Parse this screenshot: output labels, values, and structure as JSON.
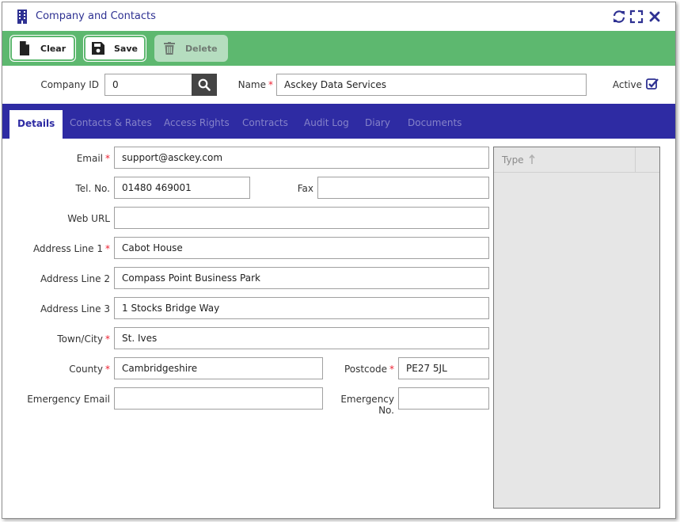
{
  "window": {
    "title": "Company and Contacts"
  },
  "toolbar": {
    "clear_label": "Clear",
    "save_label": "Save",
    "delete_label": "Delete"
  },
  "header": {
    "company_id_label": "Company ID",
    "company_id_value": "0",
    "name_label": "Name",
    "name_value": "Asckey Data Services",
    "active_label": "Active",
    "active_checked": true,
    "required_marker": "*"
  },
  "tabs": [
    {
      "label": "Details",
      "active": true
    },
    {
      "label": "Contacts & Rates",
      "active": false
    },
    {
      "label": "Access Rights",
      "active": false
    },
    {
      "label": "Contracts",
      "active": false
    },
    {
      "label": "Audit Log",
      "active": false
    },
    {
      "label": "Diary",
      "active": false
    },
    {
      "label": "Documents",
      "active": false
    }
  ],
  "form": {
    "email_label": "Email",
    "email_value": "support@asckey.com",
    "tel_label": "Tel. No.",
    "tel_value": "01480 469001",
    "fax_label": "Fax",
    "fax_value": "",
    "web_label": "Web URL",
    "web_value": "",
    "addr1_label": "Address Line 1",
    "addr1_value": "Cabot House",
    "addr2_label": "Address Line 2",
    "addr2_value": "Compass Point Business Park",
    "addr3_label": "Address Line 3",
    "addr3_value": "1 Stocks Bridge Way",
    "town_label": "Town/City",
    "town_value": "St. Ives",
    "county_label": "County",
    "county_value": "Cambridgeshire",
    "postcode_label": "Postcode",
    "postcode_value": "PE27 5JL",
    "em_email_label": "Emergency Email",
    "em_email_value": "",
    "em_no_label": "Emergency No.",
    "em_no_value": ""
  },
  "side_panel": {
    "column_label": "Type",
    "sort_icon": "sort-arrow-up-icon"
  },
  "colors": {
    "title": "#2e3192",
    "toolbar": "#5db86f",
    "tabbar": "#2e2ba3",
    "required": "#ee2233"
  }
}
